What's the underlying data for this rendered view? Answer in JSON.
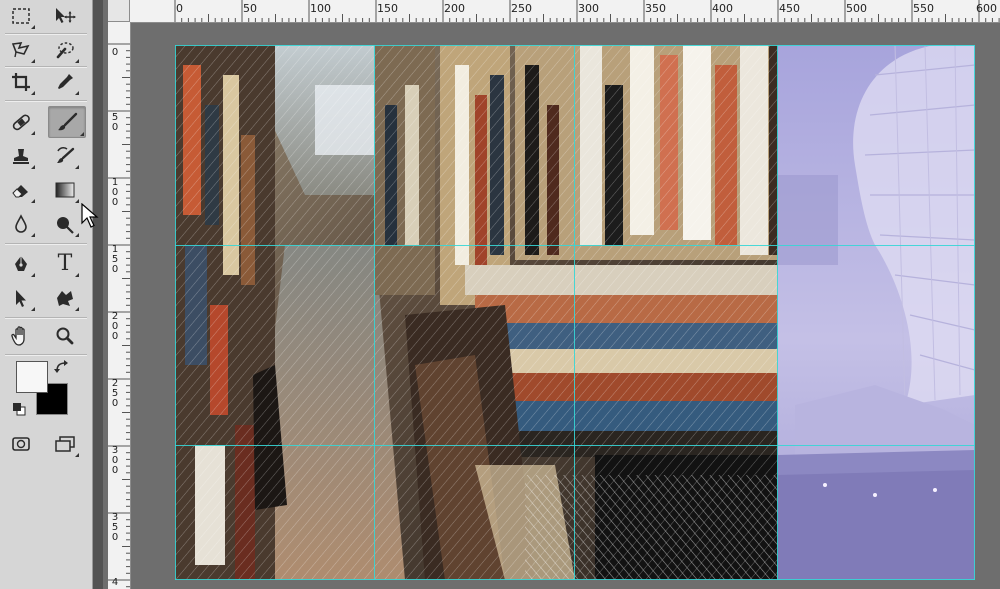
{
  "app": {
    "accent": "#36d6d6"
  },
  "toolbar": {
    "tools": [
      {
        "name": "rectangular-marquee-tool",
        "icon": "marquee-icon"
      },
      {
        "name": "move-tool",
        "icon": "move-icon"
      },
      {
        "name": "lasso-tool",
        "icon": "lasso-icon"
      },
      {
        "name": "quick-selection-tool",
        "icon": "quick-selection-icon"
      },
      {
        "name": "crop-tool",
        "icon": "crop-icon"
      },
      {
        "name": "eyedropper-tool",
        "icon": "eyedropper-icon"
      },
      {
        "name": "spot-healing-tool",
        "icon": "bandage-icon"
      },
      {
        "name": "brush-tool",
        "icon": "brush-icon",
        "active": true
      },
      {
        "name": "clone-stamp-tool",
        "icon": "stamp-icon"
      },
      {
        "name": "history-brush-tool",
        "icon": "history-brush-icon"
      },
      {
        "name": "eraser-tool",
        "icon": "eraser-icon"
      },
      {
        "name": "gradient-tool",
        "icon": "gradient-icon"
      },
      {
        "name": "blur-tool",
        "icon": "blur-drop-icon"
      },
      {
        "name": "dodge-tool",
        "icon": "dodge-icon"
      },
      {
        "name": "pen-tool",
        "icon": "pen-icon"
      },
      {
        "name": "type-tool",
        "icon": "type-icon",
        "label": "T"
      },
      {
        "name": "path-selection-tool",
        "icon": "path-arrow-icon"
      },
      {
        "name": "custom-shape-tool",
        "icon": "shape-icon"
      },
      {
        "name": "hand-tool",
        "icon": "hand-icon"
      },
      {
        "name": "zoom-tool",
        "icon": "zoom-icon"
      }
    ],
    "foreground_color": "#f7f7f7",
    "background_color": "#000000"
  },
  "ruler_top": {
    "labels": [
      "0",
      "50",
      "100",
      "150",
      "200",
      "250",
      "300",
      "350",
      "400",
      "450",
      "500",
      "550",
      "600"
    ]
  },
  "ruler_left": {
    "labels": [
      "0",
      "50",
      "100",
      "150",
      "200",
      "250",
      "300",
      "350",
      "4"
    ]
  },
  "document": {
    "guides_vertical_pct": [
      0,
      25,
      50,
      75,
      100
    ],
    "guides_horizontal_pct": [
      0,
      37.5,
      75,
      100
    ]
  }
}
